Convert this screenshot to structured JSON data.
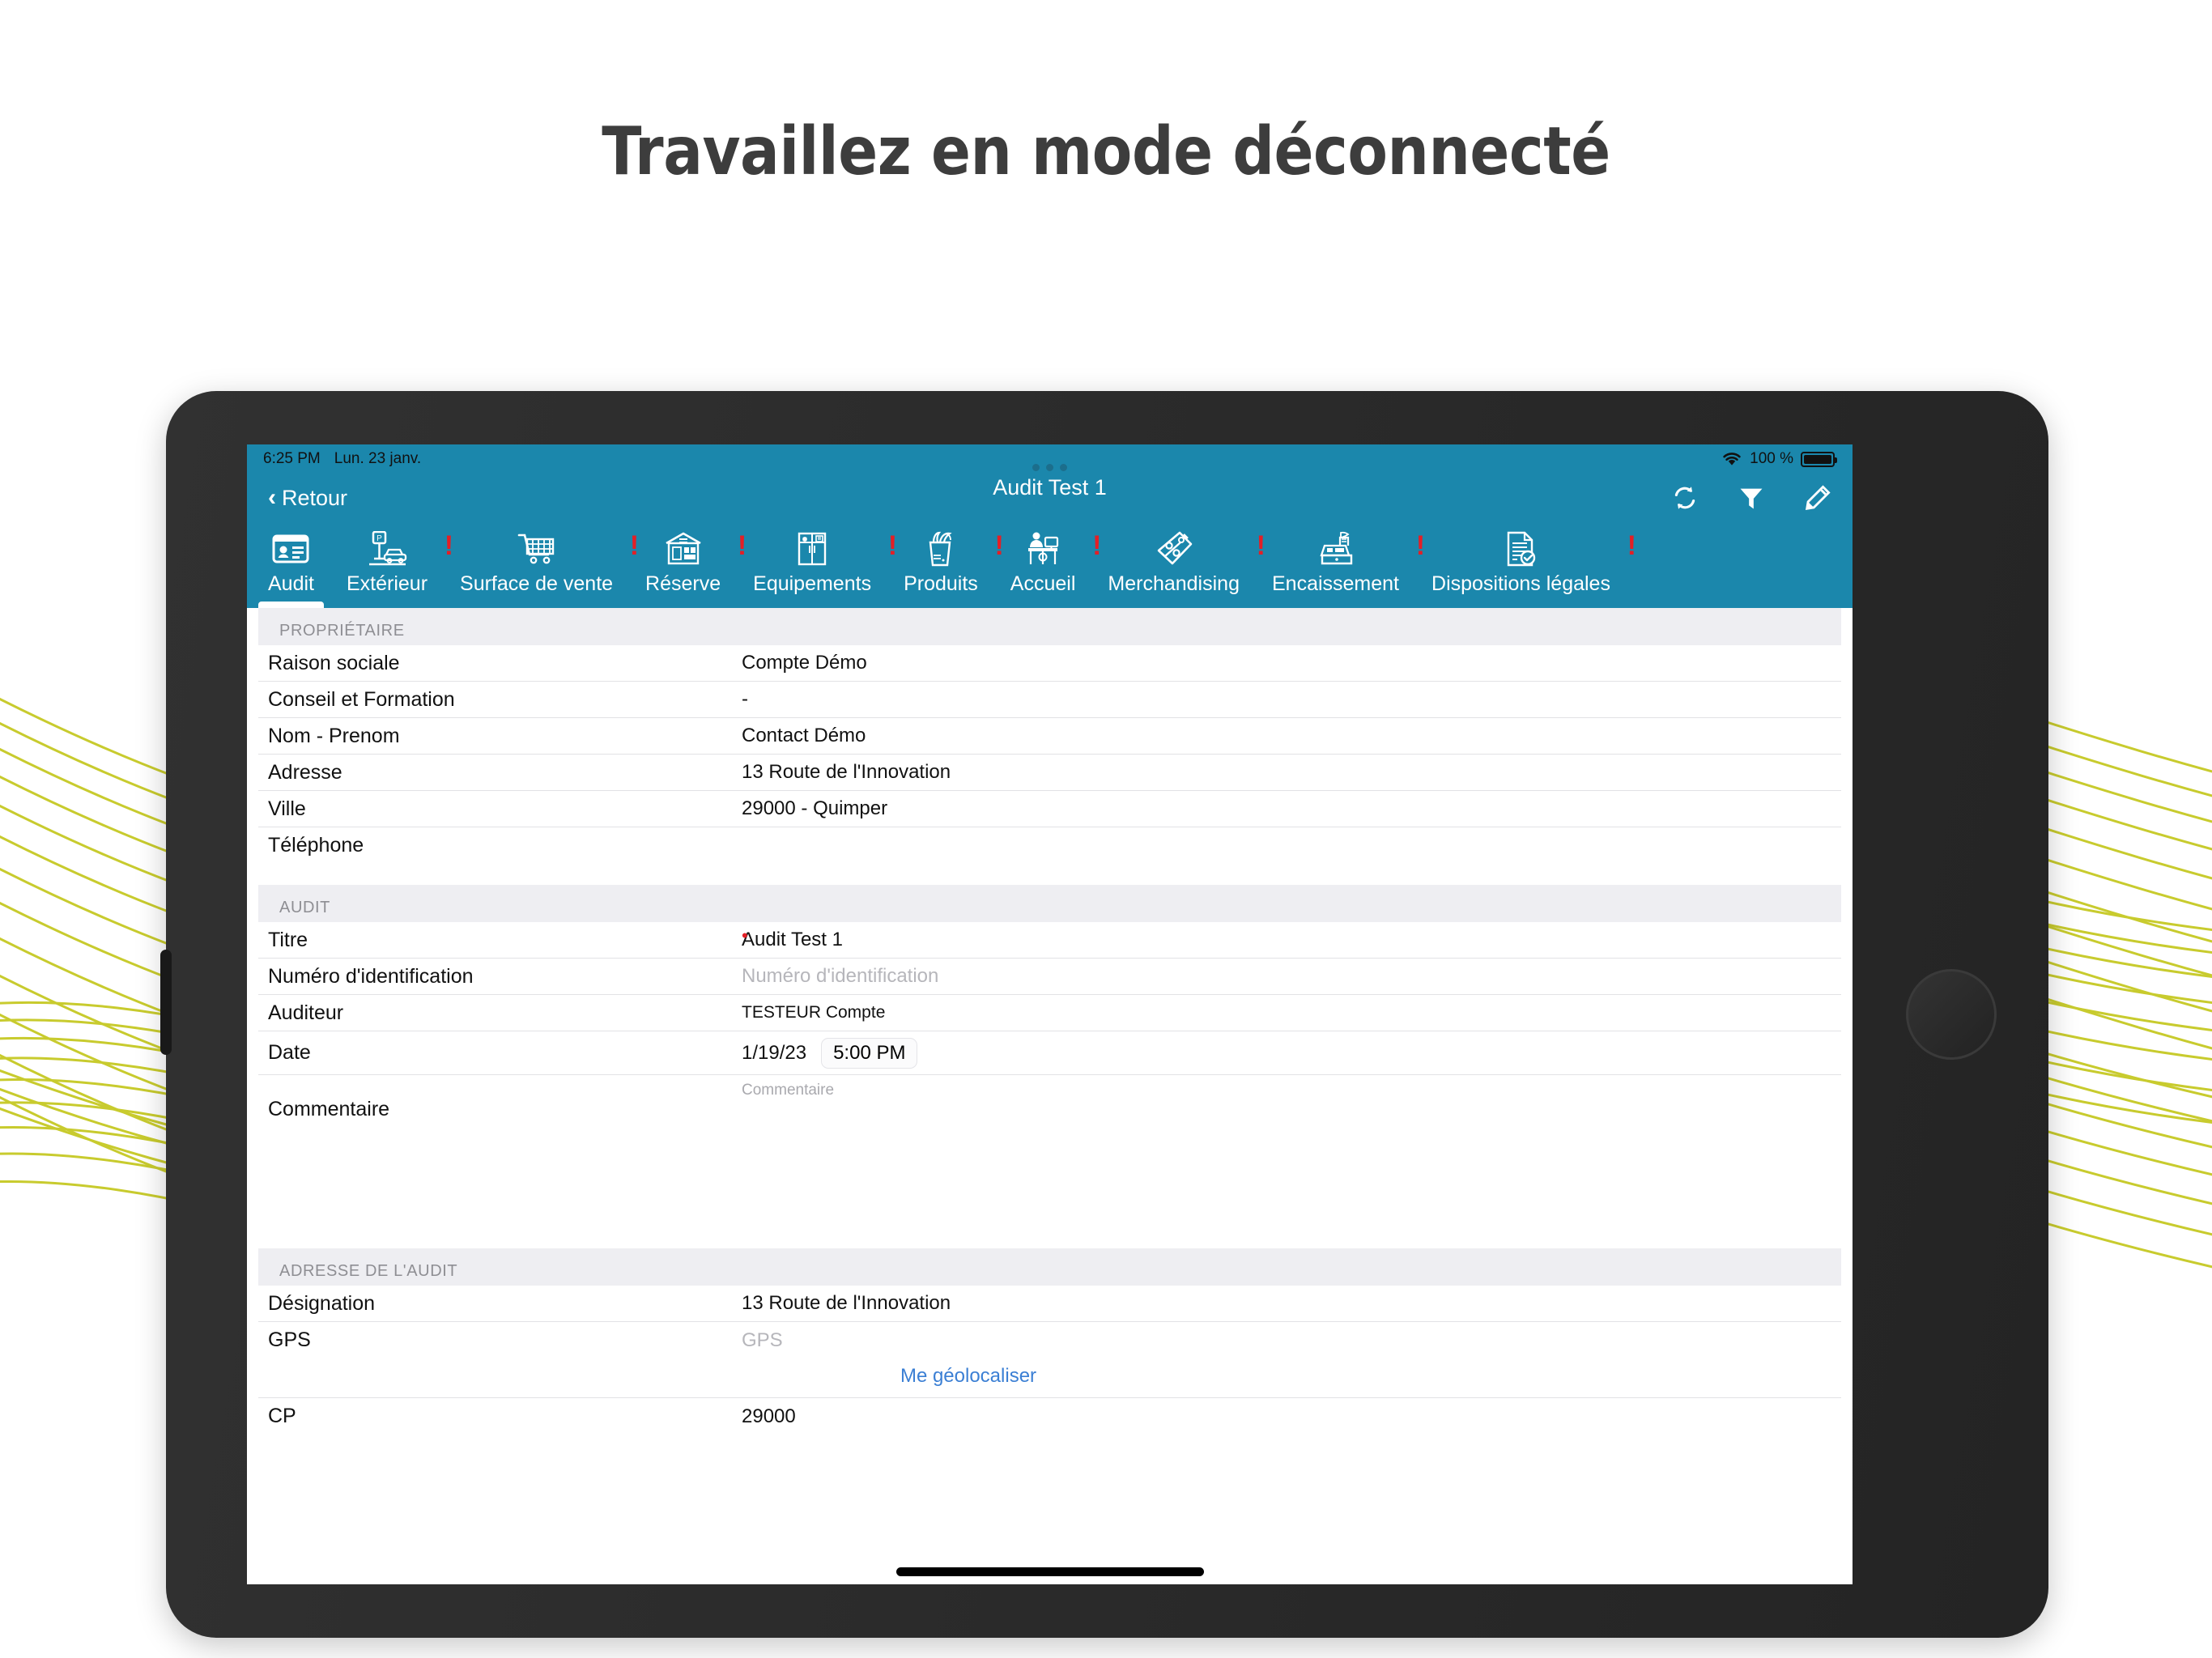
{
  "headline": "Travaillez en mode déconnecté",
  "status_bar": {
    "time": "6:25 PM",
    "date": "Lun. 23 janv.",
    "battery_percent": "100 %",
    "wifi_icon": "wifi-icon",
    "battery_icon": "battery-icon"
  },
  "nav": {
    "back_label": "Retour",
    "back_chevron": "‹",
    "title": "Audit Test 1",
    "actions": [
      {
        "name": "sync-button",
        "icon": "refresh-icon"
      },
      {
        "name": "filter-button",
        "icon": "funnel-icon"
      },
      {
        "name": "edit-button",
        "icon": "pencil-icon"
      }
    ]
  },
  "tabs": [
    {
      "label": "Audit",
      "icon": "id-card-icon",
      "active": true,
      "alert": false
    },
    {
      "label": "Extérieur",
      "icon": "parking-car-icon",
      "active": false,
      "alert": true
    },
    {
      "label": "Surface de vente",
      "icon": "shopping-cart-icon",
      "active": false,
      "alert": true
    },
    {
      "label": "Réserve",
      "icon": "warehouse-icon",
      "active": false,
      "alert": true
    },
    {
      "label": "Equipements",
      "icon": "fridge-icon",
      "active": false,
      "alert": true
    },
    {
      "label": "Produits",
      "icon": "grocery-bag-icon",
      "active": false,
      "alert": true
    },
    {
      "label": "Accueil",
      "icon": "reception-desk-icon",
      "active": false,
      "alert": true
    },
    {
      "label": "Merchandising",
      "icon": "price-tag-percent-icon",
      "active": false,
      "alert": true
    },
    {
      "label": "Encaissement",
      "icon": "cash-register-icon",
      "active": false,
      "alert": true
    },
    {
      "label": "Dispositions légales",
      "icon": "legal-document-icon",
      "active": false,
      "alert": true
    }
  ],
  "sections": [
    {
      "title": "PROPRIÉTAIRE",
      "rows": [
        {
          "label": "Raison sociale",
          "value": "Compte Démo",
          "placeholder": false
        },
        {
          "label": "Conseil et Formation",
          "value": "-",
          "placeholder": false
        },
        {
          "label": "Nom - Prenom",
          "value": "Contact Démo",
          "placeholder": false
        },
        {
          "label": "Adresse",
          "value": "13 Route de l'Innovation",
          "placeholder": false
        },
        {
          "label": "Ville",
          "value": "29000 - Quimper",
          "placeholder": false
        },
        {
          "label": "Téléphone",
          "value": "",
          "placeholder": false
        }
      ]
    },
    {
      "title": "AUDIT",
      "rows": [
        {
          "label": "Titre",
          "value": "Audit Test 1",
          "placeholder": false,
          "required": true
        },
        {
          "label": "Numéro d'identification",
          "value": "Numéro d'identification",
          "placeholder": true
        },
        {
          "label": "Auditeur",
          "value": "TESTEUR Compte",
          "placeholder": false,
          "small": true
        },
        {
          "label": "Date",
          "value": "1/19/23",
          "time": "5:00 PM",
          "placeholder": false
        }
      ],
      "comment": {
        "label": "Commentaire",
        "placeholder": "Commentaire"
      }
    },
    {
      "title": "ADRESSE DE L'AUDIT",
      "rows": [
        {
          "label": "Désignation",
          "value": "13 Route de l'Innovation",
          "placeholder": false
        },
        {
          "label": "GPS",
          "value": "GPS",
          "placeholder": true
        }
      ],
      "geolocate_label": "Me géolocaliser",
      "last_row": {
        "label": "CP",
        "value": "29000",
        "placeholder": false
      }
    }
  ],
  "colors": {
    "teal": "#1b87ac",
    "alert_red": "#e31f26",
    "link_blue": "#3b7fd4",
    "wave_yellow": "#c8cb2e",
    "section_band": "#eeeef2"
  }
}
